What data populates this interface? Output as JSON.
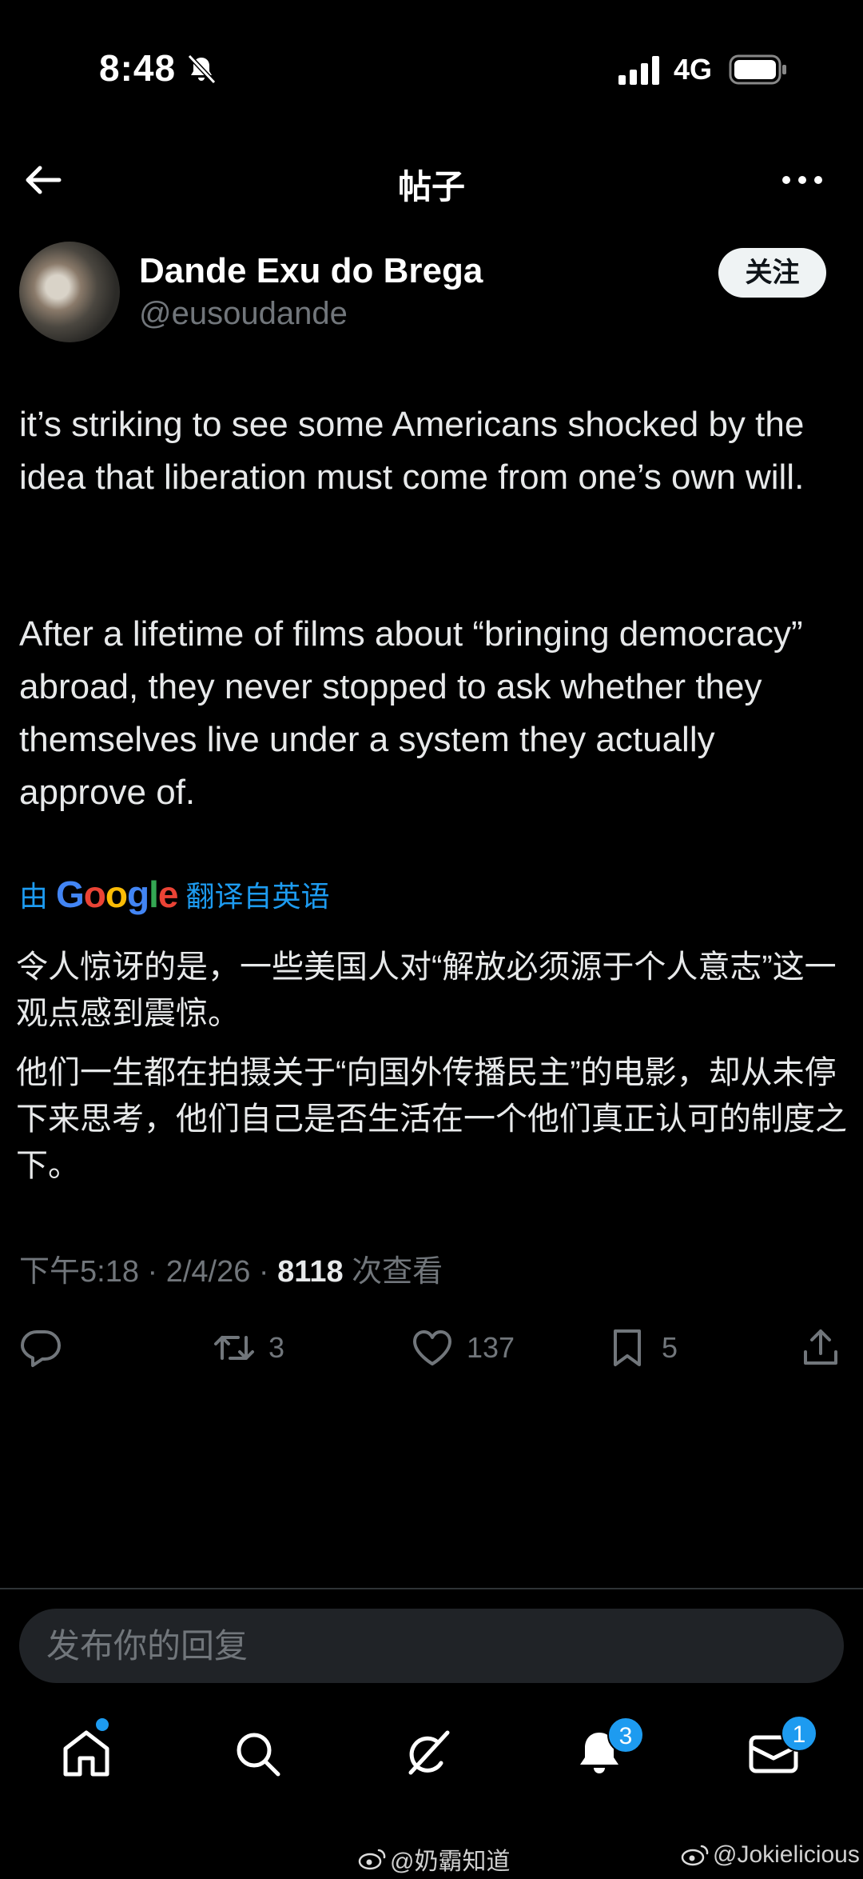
{
  "status_bar": {
    "time": "8:48",
    "network": "4G"
  },
  "header": {
    "title": "帖子"
  },
  "author": {
    "name": "Dande Exu do Brega",
    "handle": "@eusoudande",
    "follow_label": "关注"
  },
  "post": {
    "paragraphs": [
      "it’s striking to see some Americans shocked by the idea that liberation must come from one’s own will.",
      "After a lifetime of films about “bringing democracy” abroad, they never stopped to ask whether they themselves live under a system they actually approve of."
    ],
    "translation_prefix": "由",
    "translation_brand": "Google",
    "translation_suffix": "翻译自英语",
    "translated_paragraphs": [
      "令人惊讶的是，一些美国人对“解放必须源于个人意志”这一观点感到震惊。",
      "他们一生都在拍摄关于“向国外传播民主”的电影，却从未停下来思考，他们自己是否生活在一个他们真正认可的制度之下。"
    ],
    "timestamp": "下午5:18 · 2/4/26 ·",
    "views_count": "8118",
    "views_label": "次查看"
  },
  "actions": {
    "retweets": "3",
    "likes": "137",
    "bookmarks": "5"
  },
  "reply_box": {
    "placeholder": "发布你的回复"
  },
  "nav": {
    "notifications_badge": "3",
    "messages_badge": "1"
  },
  "watermarks": [
    "@奶霸知道",
    "@Jokielicious"
  ],
  "colors": {
    "accent": "#1d9bf0",
    "background": "#000000",
    "muted": "#71767b"
  }
}
